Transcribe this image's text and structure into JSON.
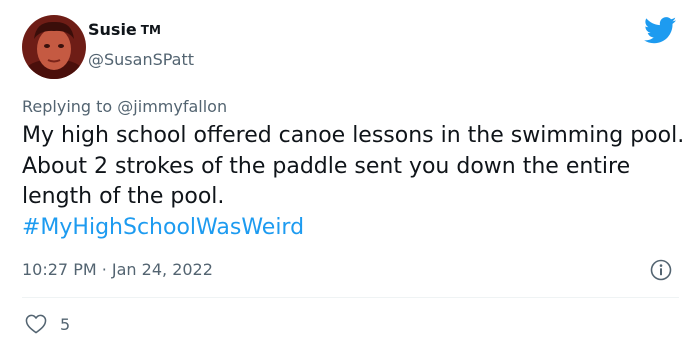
{
  "author": {
    "display_name": "Susie",
    "tm": "TM",
    "handle": "@SusanSPatt",
    "avatar_icon": "user-avatar-photo"
  },
  "reply": {
    "prefix": "Replying to ",
    "mention": "@jimmyfallon"
  },
  "tweet": {
    "text": "My high school offered canoe lessons in the swimming pool. About 2 strokes of the paddle sent you down the entire length of the pool.",
    "hashtag": "#MyHighSchoolWasWeird",
    "timestamp": "10:27 PM · Jan 24, 2022"
  },
  "actions": {
    "like_count": "5"
  },
  "icons": {
    "brand": "twitter-bird-icon",
    "info": "info-icon",
    "like": "heart-icon"
  },
  "colors": {
    "twitter_blue": "#1d9bf0",
    "secondary_text": "#536471",
    "primary_text": "#0f1419"
  }
}
